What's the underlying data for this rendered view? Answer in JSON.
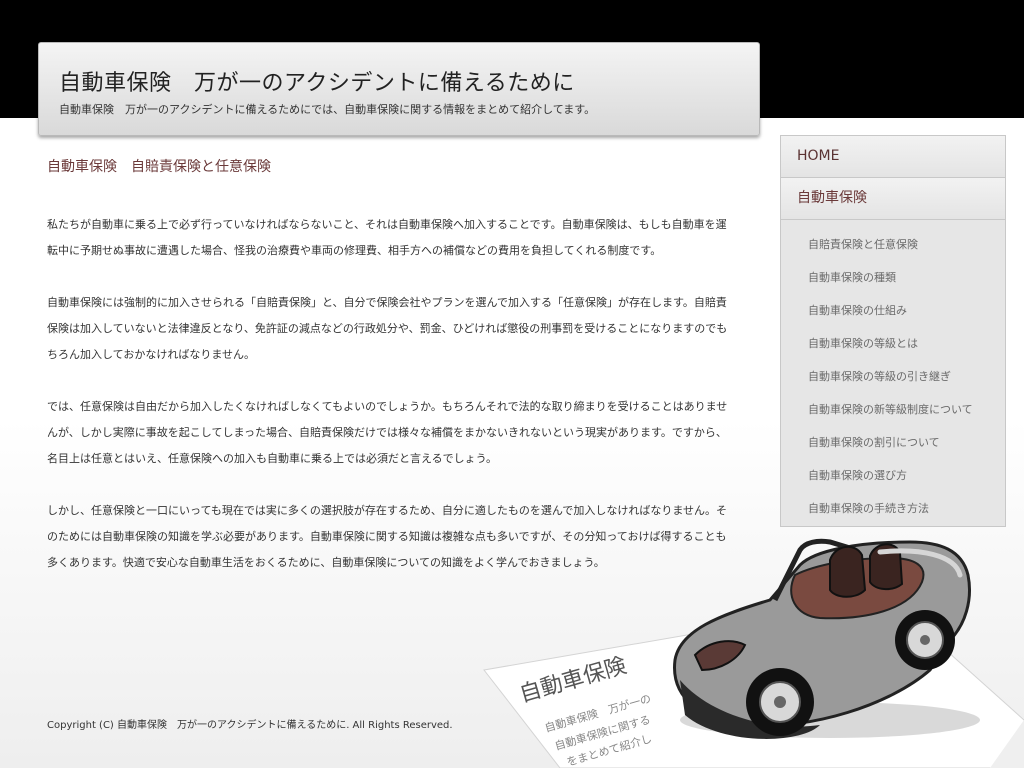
{
  "header": {
    "title": "自動車保険　万が一のアクシデントに備えるために",
    "description": "自動車保険　万が一のアクシデントに備えるためにでは、自動車保険に関する情報をまとめて紹介してます。"
  },
  "main": {
    "title": "自動車保険　自賠責保険と任意保険",
    "paragraphs": [
      "私たちが自動車に乗る上で必ず行っていなければならないこと、それは自動車保険へ加入することです。自動車保険は、もしも自動車を運転中に予期せぬ事故に遭遇した場合、怪我の治療費や車両の修理費、相手方への補償などの費用を負担してくれる制度です。",
      "自動車保険には強制的に加入させられる「自賠責保険」と、自分で保険会社やプランを選んで加入する「任意保険」が存在します。自賠責保険は加入していないと法律違反となり、免許証の減点などの行政処分や、罰金、ひどければ懲役の刑事罰を受けることになりますのでもちろん加入しておかなければなりません。",
      "では、任意保険は自由だから加入したくなければしなくてもよいのでしょうか。もちろんそれで法的な取り締まりを受けることはありませんが、しかし実際に事故を起こしてしまった場合、自賠責保険だけでは様々な補償をまかないきれないという現実があります。ですから、名目上は任意とはいえ、任意保険への加入も自動車に乗る上では必須だと言えるでしょう。",
      "しかし、任意保険と一口にいっても現在では実に多くの選択肢が存在するため、自分に適したものを選んで加入しなければなりません。そのためには自動車保険の知識を学ぶ必要があります。自動車保険に関する知識は複雑な点も多いですが、その分知っておけば得することも多くあります。快適で安心な自動車生活をおくるために、自動車保険についての知識をよく学んでおきましょう。"
    ]
  },
  "sidebar": {
    "home": "HOME",
    "category": "自動車保険",
    "items": [
      "自賠責保険と任意保険",
      "自動車保険の種類",
      "自動車保険の仕組み",
      "自動車保険の等級とは",
      "自動車保険の等級の引き継ぎ",
      "自動車保険の新等級制度について",
      "自動車保険の割引について",
      "自動車保険の選び方",
      "自動車保険の手続き方法"
    ]
  },
  "footer": {
    "copyright": "Copyright (C)  自動車保険　万が一のアクシデントに備えるために.  All Rights Reserved."
  },
  "illustration": {
    "document_heading": "自動車保険",
    "document_lines": [
      "自動車保険　万が一の",
      "自動車保険に関する",
      "をまとめて紹介し"
    ],
    "car_color": "#9a9a9a"
  }
}
